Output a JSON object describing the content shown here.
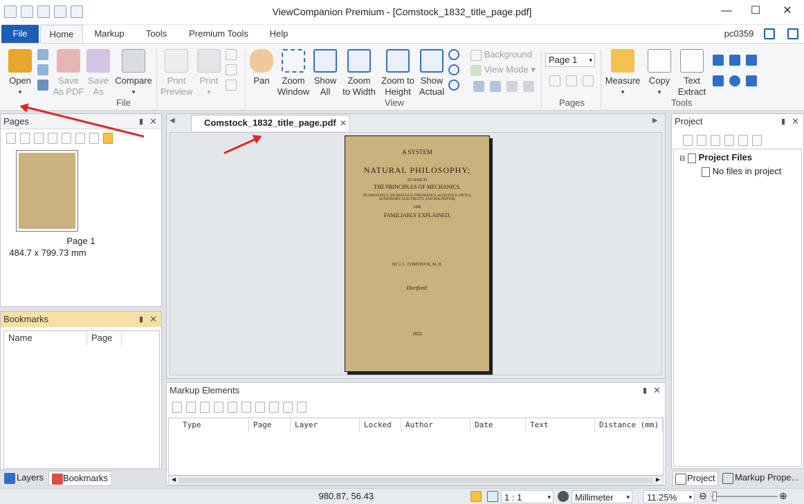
{
  "window": {
    "title": "ViewCompanion Premium - [Comstock_1832_title_page.pdf]",
    "user": "pc0359"
  },
  "ribbon_tabs": [
    "File",
    "Home",
    "Markup",
    "Tools",
    "Premium Tools",
    "Help"
  ],
  "ribbon": {
    "open": "Open",
    "save_as_pdf": [
      "Save",
      "As PDF"
    ],
    "save_as": [
      "Save",
      "As"
    ],
    "compare": "Compare",
    "print_preview": [
      "Print",
      "Preview"
    ],
    "print": "Print",
    "file_group": "File",
    "pan": "Pan",
    "zoom_window": [
      "Zoom",
      "Window"
    ],
    "show_all": [
      "Show",
      "All"
    ],
    "zoom_width": [
      "Zoom",
      "to Width"
    ],
    "zoom_height": [
      "Zoom to",
      "Height"
    ],
    "show_actual": [
      "Show",
      "Actual"
    ],
    "background": "Background",
    "view_mode": "View Mode",
    "view_group": "View",
    "page_select": "Page 1",
    "pages_group": "Pages",
    "measure": "Measure",
    "copy": "Copy",
    "text_extract": [
      "Text",
      "Extract"
    ],
    "tools_group": "Tools"
  },
  "pages_panel": {
    "title": "Pages",
    "thumb_label": "Page 1",
    "thumb_size": "484.7 x 799.73 mm"
  },
  "bookmarks_panel": {
    "title": "Bookmarks",
    "columns": [
      "Name",
      "Page"
    ]
  },
  "left_tabs": [
    "Layers",
    "Bookmarks"
  ],
  "document": {
    "tab": "Comstock_1832_title_page.pdf",
    "page_lines": {
      "l1": "A SYSTEM",
      "l2": "NATURAL PHILOSOPHY;",
      "l3": "IN WHICH",
      "l4": "THE PRINCIPLES OF MECHANICS,",
      "l5": "HYDROSTATICS, HYDRAULICS, PNEUMATICS, ACOUSTICS, OPTICS,",
      "l6": "ASTRONOMY, ELECTRICITY, AND MAGNETISM,",
      "l7": "ARE",
      "l8": "FAMILIARLY EXPLAINED,",
      "l9": "BY J. L. COMSTOCK, M. D.",
      "l10": "Hartford:",
      "l11": "1832"
    }
  },
  "markup_panel": {
    "title": "Markup Elements",
    "columns": [
      "Type",
      "Page",
      "Layer",
      "Locked",
      "Author",
      "Date",
      "Text",
      "Distance (mm)"
    ]
  },
  "project_panel": {
    "title": "Project",
    "root": "Project Files",
    "child": "No files in project"
  },
  "right_tabs": [
    "Project",
    "Markup Prope..."
  ],
  "status": {
    "coords": "980.87, 56.43",
    "scale": "1 : 1",
    "unit": "Millimeter",
    "zoom": "11.25%"
  },
  "colors": {
    "accent": "#1b5eb5",
    "arrow": "#e0262a",
    "paper": "#c9b27e"
  }
}
